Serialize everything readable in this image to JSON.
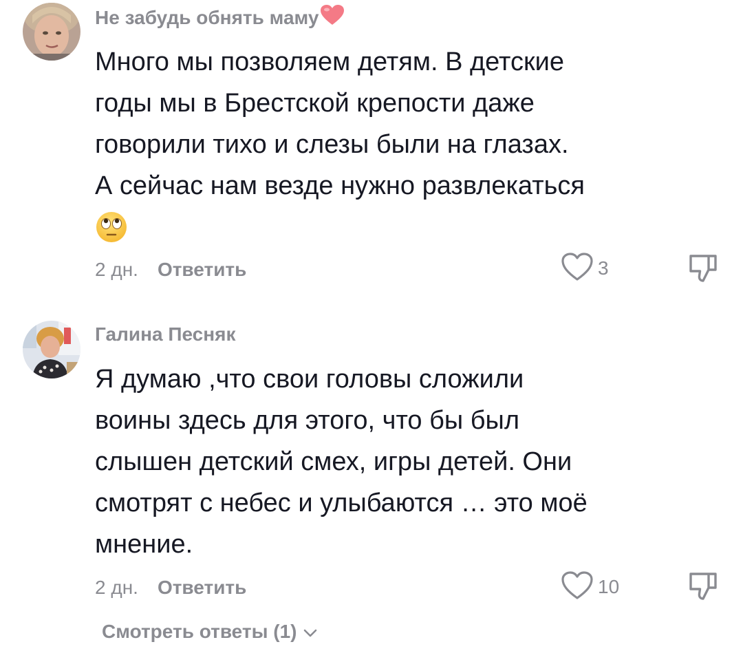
{
  "comments": [
    {
      "author": "Не забудь обнять маму",
      "author_emoji": "heart",
      "text_lines": [
        "Много мы позволяем детям. В детские",
        "годы мы в Брестской крепости даже",
        "говорили тихо и слезы были на глазах.",
        "А сейчас нам везде нужно развлекаться"
      ],
      "trailing_emoji": "face-with-rolling-eyes",
      "time": "2 дн.",
      "reply_label": "Ответить",
      "likes": "3"
    },
    {
      "author": "Галина Песняк",
      "text_lines": [
        "Я думаю ,что свои головы сложили",
        "воины здесь для этого, что бы был",
        "слышен детский смех, игры детей. Они",
        "смотрят с небес и улыбаются … это моё",
        "мнение."
      ],
      "time": "2 дн.",
      "reply_label": "Ответить",
      "likes": "10",
      "view_replies": "Смотреть ответы (1)"
    }
  ],
  "icons": {
    "like": "heart-outline-icon",
    "dislike": "thumbs-down-icon",
    "expand": "chevron-down-icon"
  },
  "colors": {
    "text": "#161823",
    "muted": "#8a8b91",
    "heart_emoji": "#f47a86"
  }
}
